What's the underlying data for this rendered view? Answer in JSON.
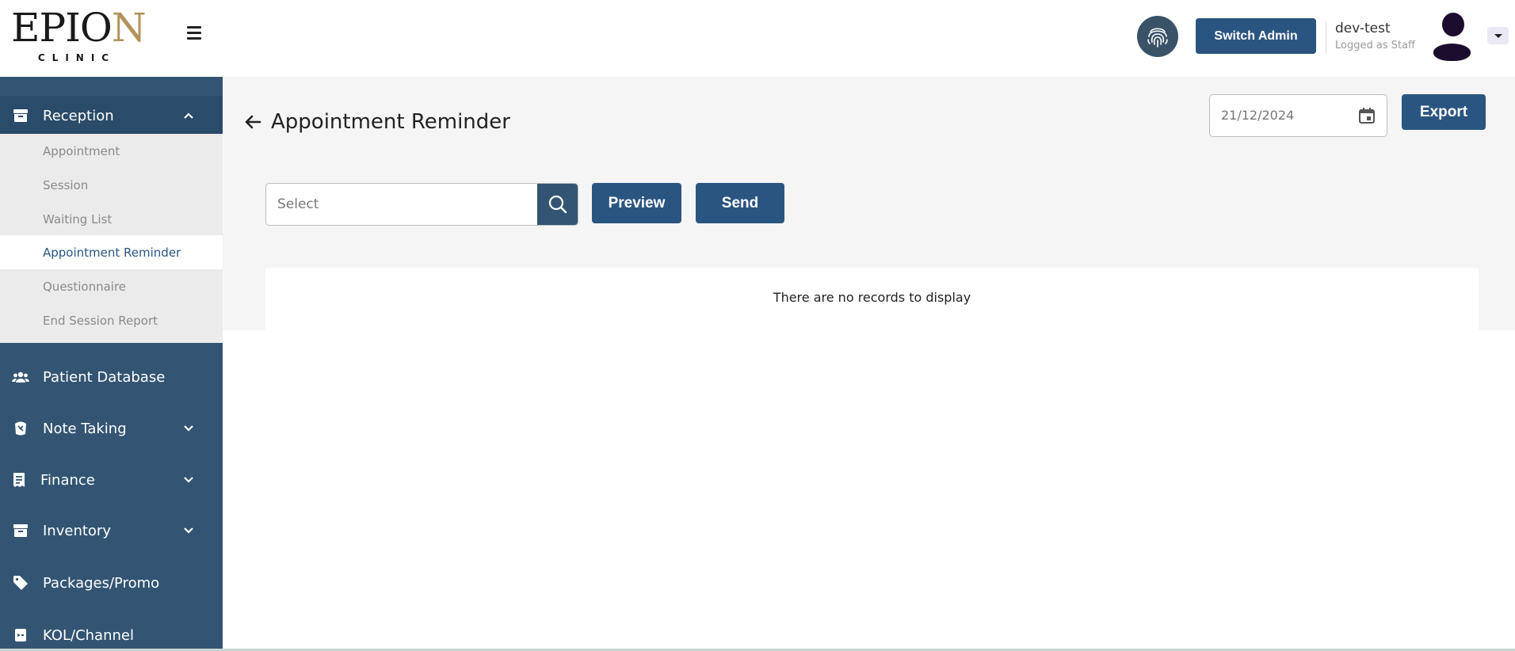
{
  "brand": {
    "logo_main_a": "EPIO",
    "logo_main_b": "N",
    "logo_sub": "CLINIC"
  },
  "header": {
    "switch_admin_label": "Switch Admin",
    "user_name": "dev-test",
    "user_role": "Logged as Staff"
  },
  "sidebar": {
    "reception_label": "Reception",
    "reception_items": [
      {
        "label": "Appointment"
      },
      {
        "label": "Session"
      },
      {
        "label": "Waiting List"
      },
      {
        "label": "Appointment Reminder",
        "active": true
      },
      {
        "label": "Questionnaire"
      },
      {
        "label": "End Session Report"
      }
    ],
    "groups": [
      {
        "label": "Patient Database",
        "icon": "users-icon"
      },
      {
        "label": "Note Taking",
        "icon": "notes-icon"
      },
      {
        "label": "Finance",
        "icon": "receipt-icon"
      },
      {
        "label": "Inventory",
        "icon": "archive-icon"
      },
      {
        "label": "Packages/Promo",
        "icon": "tag-icon"
      },
      {
        "label": "KOL/Channel",
        "icon": "channel-icon"
      }
    ]
  },
  "main": {
    "title": "Appointment Reminder",
    "date_value": "21/12/2024",
    "export_label": "Export",
    "select_placeholder": "Select",
    "preview_label": "Preview",
    "send_label": "Send",
    "empty_message": "There are no records to display"
  },
  "colors": {
    "primary": "#2b5581",
    "sidebar": "#335573",
    "sidebar_active": "#2a4b69",
    "brand_gold": "#b2935a"
  }
}
